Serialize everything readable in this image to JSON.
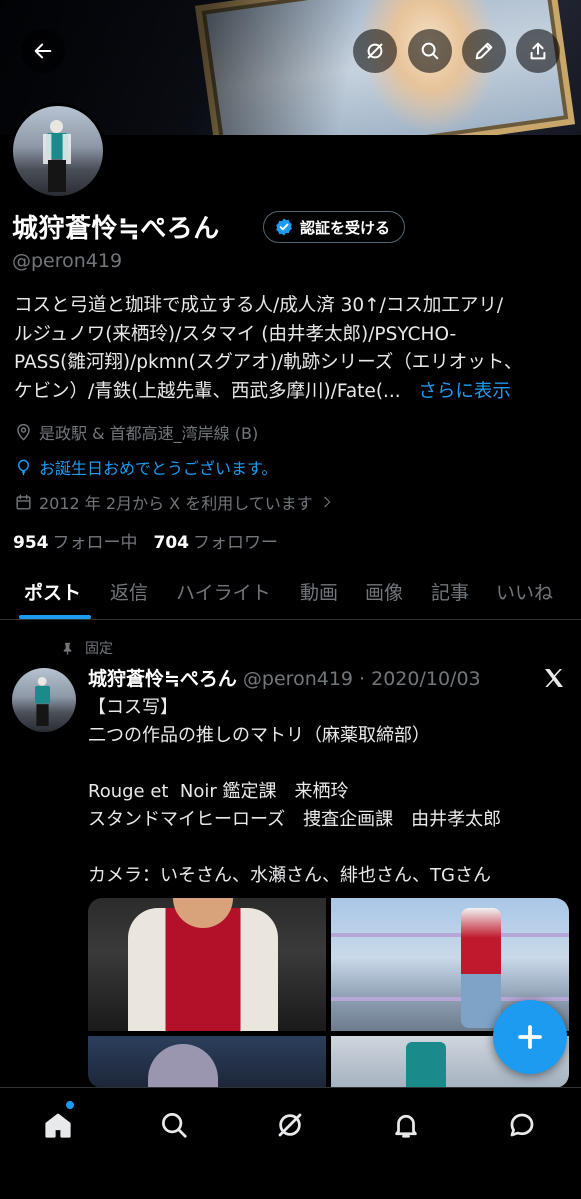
{
  "header": {
    "back_icon": "arrow-left-icon",
    "actions": [
      "grok-icon",
      "search-icon",
      "edit-icon",
      "share-icon"
    ]
  },
  "profile": {
    "display_name": "城狩蒼怜≒ぺろん",
    "verify_label": "認証を受ける",
    "handle": "@peron419",
    "bio_lines": [
      "コスと弓道と珈琲で成立する人/成人済 30↑/コス加工アリ/",
      "ルジュノワ(来栖玲)/スタマイ (由井孝太郎)/PSYCHO-",
      "PASS(雛河翔)/pkmn(スグアオ)/軌跡シリーズ（エリオット、",
      "ケビン）/青鉄(上越先輩、西武多摩川)/Fate(..."
    ],
    "bio_more": "さらに表示",
    "location": "是政駅 & 首都高速_湾岸線 (B)",
    "birthday_message": "お誕生日おめでとうございます。",
    "joined": "2012 年 2月から X を利用しています",
    "following_count": "954",
    "following_label": "フォロー中",
    "followers_count": "704",
    "followers_label": "フォロワー"
  },
  "tabs": [
    {
      "label": "ポスト",
      "active": true
    },
    {
      "label": "返信"
    },
    {
      "label": "ハイライト"
    },
    {
      "label": "動画"
    },
    {
      "label": "画像"
    },
    {
      "label": "記事"
    },
    {
      "label": "いいね"
    }
  ],
  "post": {
    "pinned_label": "固定",
    "author": "城狩蒼怜≒ぺろん",
    "handle_date": "@peron419 · 2020/10/03",
    "lines": [
      "【コス写】",
      "二つの作品の推しのマトリ（麻薬取締部）",
      "",
      "Rouge et  Noir 鑑定課　来栖玲",
      "スタンドマイヒーローズ　捜査企画課　由井孝太郎",
      "",
      "カメラ：いそさん、水瀬さん、緋也さん、TGさん"
    ]
  },
  "fab_icon": "plus-icon",
  "bottom_nav": [
    "home-icon",
    "search-icon",
    "grok-icon",
    "notifications-icon",
    "messages-icon"
  ],
  "colors": {
    "accent": "#1d9bf0",
    "background": "#000000",
    "muted": "#71767b"
  }
}
